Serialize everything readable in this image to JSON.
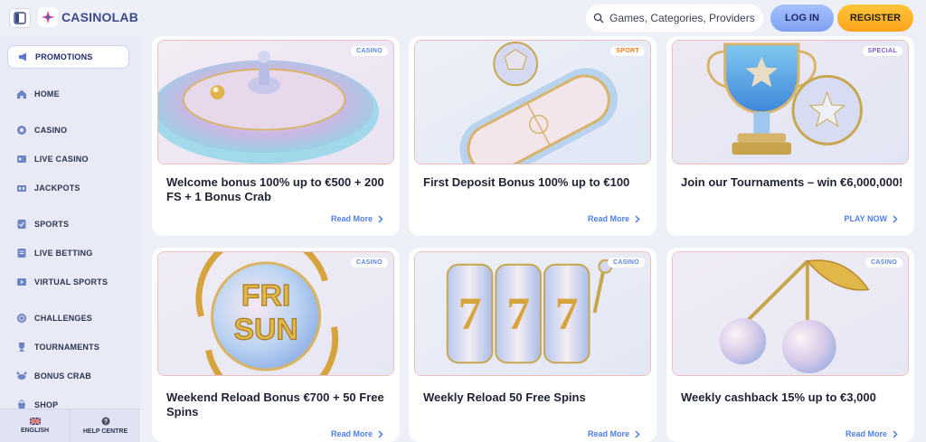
{
  "header": {
    "logo_text": "CASINOLAB",
    "search_placeholder": "Games, Categories, Providers",
    "login_label": "LOG IN",
    "register_label": "REGISTER"
  },
  "sidebar": {
    "items": [
      {
        "label": "PROMOTIONS",
        "icon": "megaphone-icon"
      },
      {
        "label": "HOME",
        "icon": "home-icon"
      },
      {
        "label": "CASINO",
        "icon": "chip-icon"
      },
      {
        "label": "LIVE CASINO",
        "icon": "live-casino-icon"
      },
      {
        "label": "JACKPOTS",
        "icon": "jackpot-icon"
      },
      {
        "label": "SPORTS",
        "icon": "sports-icon"
      },
      {
        "label": "LIVE BETTING",
        "icon": "live-betting-icon"
      },
      {
        "label": "VIRTUAL SPORTS",
        "icon": "virtual-sports-icon"
      },
      {
        "label": "CHALLENGES",
        "icon": "challenges-icon"
      },
      {
        "label": "TOURNAMENTS",
        "icon": "trophy-icon"
      },
      {
        "label": "BONUS CRAB",
        "icon": "crab-icon"
      },
      {
        "label": "SHOP",
        "icon": "shop-icon"
      }
    ],
    "bottom": {
      "language_label": "ENGLISH",
      "help_label": "HELP CENTRE"
    }
  },
  "promotions": [
    {
      "badge": "CASINO",
      "badge_color": "#5b86e5",
      "title": "Welcome bonus 100% up to €500 + 200 FS + 1 Bonus Crab",
      "link": "Read More"
    },
    {
      "badge": "SPORT",
      "badge_color": "#ff7a1a",
      "title": "First Deposit Bonus 100% up to €100",
      "link": "Read More"
    },
    {
      "badge": "SPECIAL",
      "badge_color": "#7a5bd6",
      "title": "Join our Tournaments – win €6,000,000!",
      "link": "PLAY NOW"
    },
    {
      "badge": "CASINO",
      "badge_color": "#5b86e5",
      "title": "Weekend Reload Bonus €700 + 50 Free Spins",
      "link": "Read More"
    },
    {
      "badge": "CASINO",
      "badge_color": "#5b86e5",
      "title": "Weekly Reload 50 Free Spins",
      "link": "Read More"
    },
    {
      "badge": "CASINO",
      "badge_color": "#5b86e5",
      "title": "Weekly cashback 15% up to €3,000",
      "link": "Read More"
    }
  ],
  "artwork_text": {
    "fri": "FRI",
    "sun": "SUN",
    "reel_digit": "7"
  },
  "colors": {
    "accent_blue": "#4f7fe6",
    "register_orange": "#ffa21a",
    "login_blue": "#7ea0f0",
    "background": "#eef0f8"
  }
}
